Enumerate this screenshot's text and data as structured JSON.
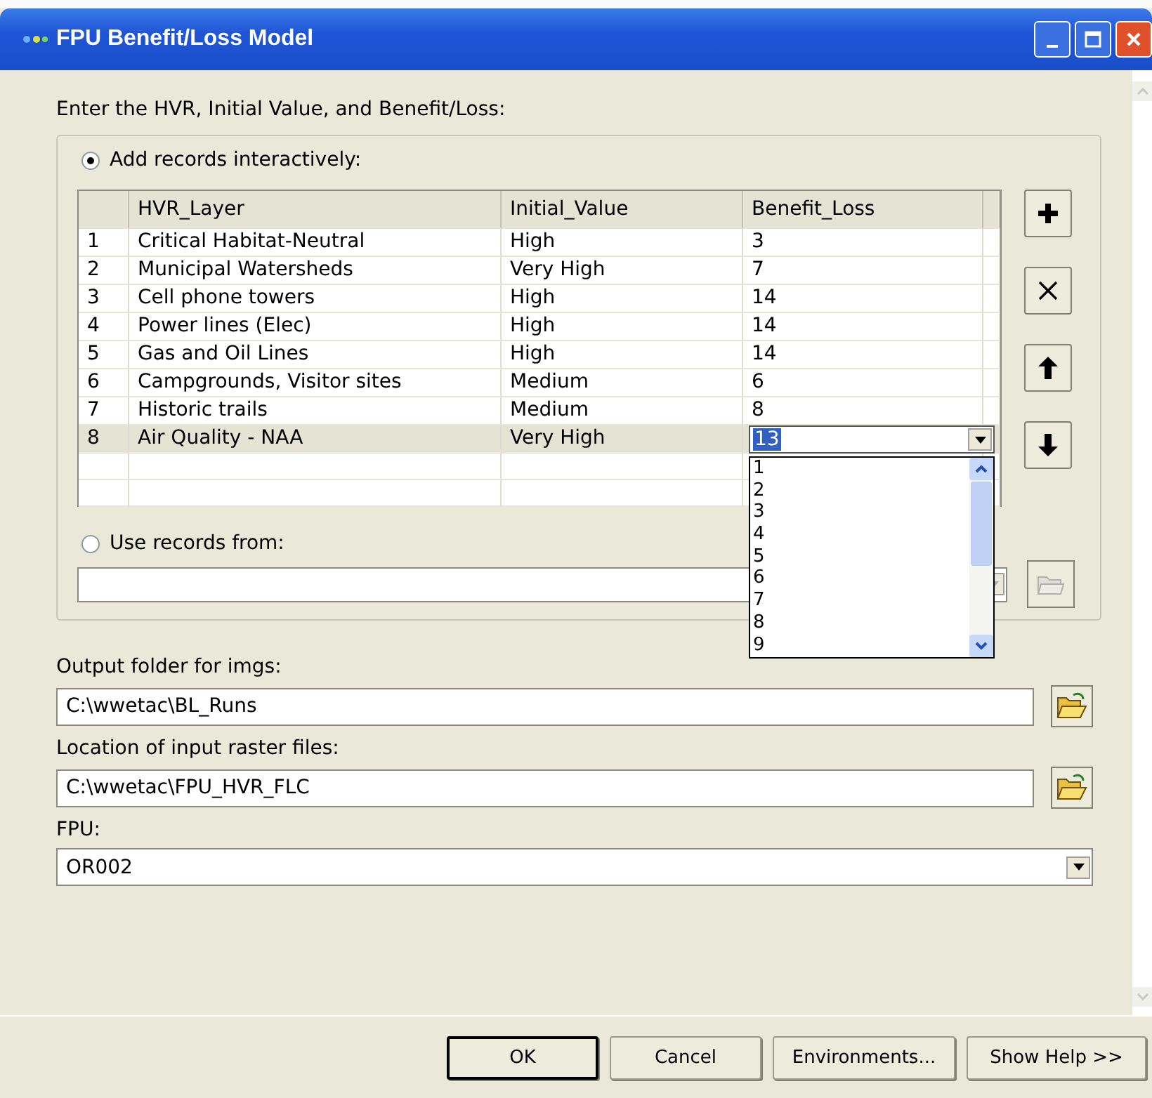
{
  "window": {
    "title": "FPU Benefit/Loss Model"
  },
  "prompt": "Enter the HVR, Initial Value, and Benefit/Loss:",
  "source_options": [
    {
      "label": "Add records interactively:",
      "selected": true
    },
    {
      "label": "Use records from:",
      "selected": false
    }
  ],
  "table": {
    "columns": [
      "HVR_Layer",
      "Initial_Value",
      "Benefit_Loss"
    ],
    "rows": [
      {
        "index": "1",
        "cells": [
          "Critical Habitat-Neutral",
          "High",
          "3"
        ],
        "selected": false,
        "editing": false
      },
      {
        "index": "2",
        "cells": [
          "Municipal Watersheds",
          "Very High",
          "7"
        ],
        "selected": false,
        "editing": false
      },
      {
        "index": "3",
        "cells": [
          "Cell phone towers",
          "High",
          "14"
        ],
        "selected": false,
        "editing": false
      },
      {
        "index": "4",
        "cells": [
          "Power lines (Elec)",
          "High",
          "14"
        ],
        "selected": false,
        "editing": false
      },
      {
        "index": "5",
        "cells": [
          "Gas and Oil Lines",
          "High",
          "14"
        ],
        "selected": false,
        "editing": false
      },
      {
        "index": "6",
        "cells": [
          "Campgrounds, Visitor sites",
          "Medium",
          "6"
        ],
        "selected": false,
        "editing": false
      },
      {
        "index": "7",
        "cells": [
          "Historic trails",
          "Medium",
          "8"
        ],
        "selected": false,
        "editing": false
      },
      {
        "index": "8",
        "cells": [
          "Air Quality - NAA",
          "Very High",
          "13"
        ],
        "selected": true,
        "editing": true
      }
    ],
    "dropdown_items": [
      "1",
      "2",
      "3",
      "4",
      "5",
      "6",
      "7",
      "8",
      "9"
    ]
  },
  "row_buttons": [
    {
      "kind": "add"
    },
    {
      "kind": "delete"
    },
    {
      "kind": "up"
    },
    {
      "kind": "down"
    }
  ],
  "fields": [
    {
      "label": "Output folder for imgs:",
      "value": "C:\\wwetac\\BL_Runs",
      "kind": "folder"
    },
    {
      "label": "Location of input raster files:",
      "value": "C:\\wwetac\\FPU_HVR_FLC",
      "kind": "folder"
    },
    {
      "label": "FPU:",
      "value": "OR002",
      "kind": "combo"
    }
  ],
  "buttons": [
    {
      "label": "OK",
      "default": true
    },
    {
      "label": "Cancel",
      "default": false
    },
    {
      "label": "Environments...",
      "default": false
    },
    {
      "label": "Show Help >>",
      "default": false
    }
  ]
}
